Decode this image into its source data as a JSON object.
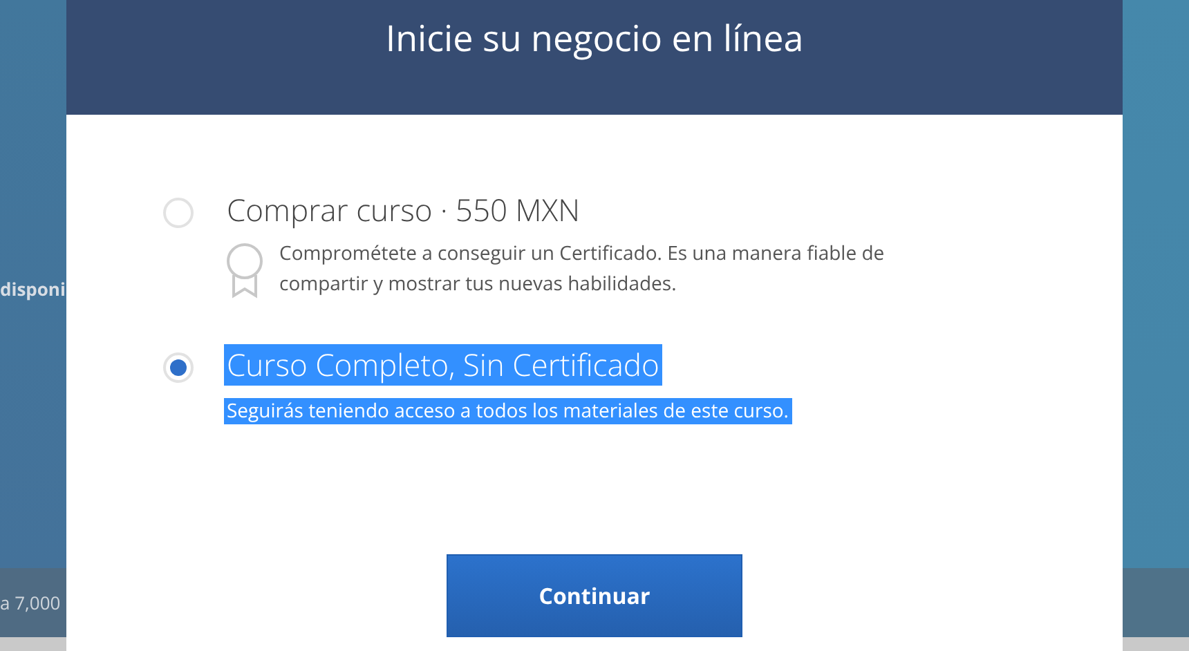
{
  "background": {
    "left_text": "disponi",
    "bottom_text": "a 7,000"
  },
  "dialog": {
    "title": "Inicie su negocio en línea",
    "options": [
      {
        "label": "Comprar curso · 550 MXN",
        "description": "Comprométete a conseguir un Certificado. Es una manera fiable de compartir y mostrar tus nuevas habilidades.",
        "kind": "certificate",
        "selected": false,
        "highlighted": false
      },
      {
        "label": "Curso Completo, Sin Certificado",
        "description": "Seguirás teniendo acceso a todos los materiales de este curso.",
        "kind": "plain",
        "selected": true,
        "highlighted": true
      }
    ],
    "button": "Continuar"
  }
}
